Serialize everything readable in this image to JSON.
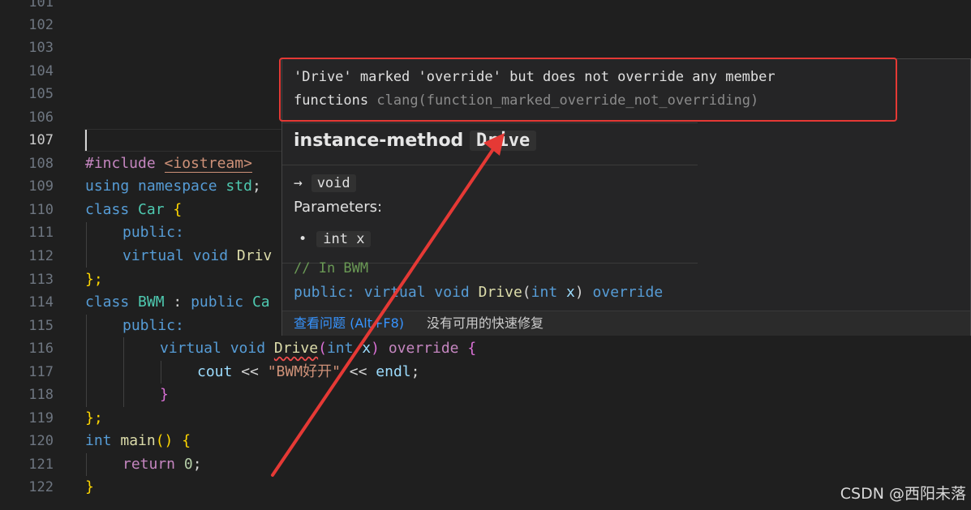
{
  "line_numbers": [
    "101",
    "102",
    "103",
    "104",
    "105",
    "106",
    "107",
    "108",
    "109",
    "110",
    "111",
    "112",
    "113",
    "114",
    "115",
    "116",
    "117",
    "118",
    "119",
    "120",
    "121",
    "122"
  ],
  "active_line": "107",
  "code": {
    "l108_kw": "#include",
    "l108_header": "<iostream>",
    "l109_using": "using",
    "l109_namespace": "namespace",
    "l109_std": "std",
    "l110_class": "class",
    "l110_name": "Car",
    "l111_public": "public:",
    "l112_virtual": "virtual",
    "l112_void": "void",
    "l112_fn": "Driv",
    "l113_close": "};",
    "l114_class": "class",
    "l114_name": "BWM",
    "l114_colon": " : ",
    "l114_public": "public",
    "l114_base": "Ca",
    "l115_public": "public:",
    "l116_virtual": "virtual",
    "l116_void": "void",
    "l116_fn": "Drive",
    "l116_int": "int",
    "l116_x": "x",
    "l116_override": "override",
    "l117_cout": "cout",
    "l117_op1": " << ",
    "l117_str": "\"BWM好开\"",
    "l117_op2": " << ",
    "l117_endl": "endl",
    "l118_close": "}",
    "l119_close": "};",
    "l120_int": "int",
    "l120_main": "main",
    "l121_return": "return",
    "l121_zero": "0",
    "l122_close": "}"
  },
  "hover": {
    "diagnostic_line1": "'Drive' marked 'override' but does not override any member",
    "diagnostic_line2": "functions",
    "diagnostic_source": "clang(function_marked_override_not_overriding)",
    "kind": "instance-method",
    "symbol": "Drive",
    "arrow": "→",
    "return_type": "void",
    "parameters_label": "Parameters:",
    "bullet": "•",
    "parameter": "int x",
    "comment": "// In BWM",
    "decl_public": "public:",
    "decl_virtual": "virtual",
    "decl_void": "void",
    "decl_fn": "Drive",
    "decl_int": "int",
    "decl_x": "x",
    "decl_override": "override",
    "view_problem": "查看问题 (Alt+F8)",
    "no_quick_fix": "没有可用的快速修复"
  },
  "watermark": "CSDN @西阳未落",
  "colors": {
    "background": "#1f1f1f",
    "annotation_red": "#e53935",
    "link_blue": "#3794ff"
  }
}
